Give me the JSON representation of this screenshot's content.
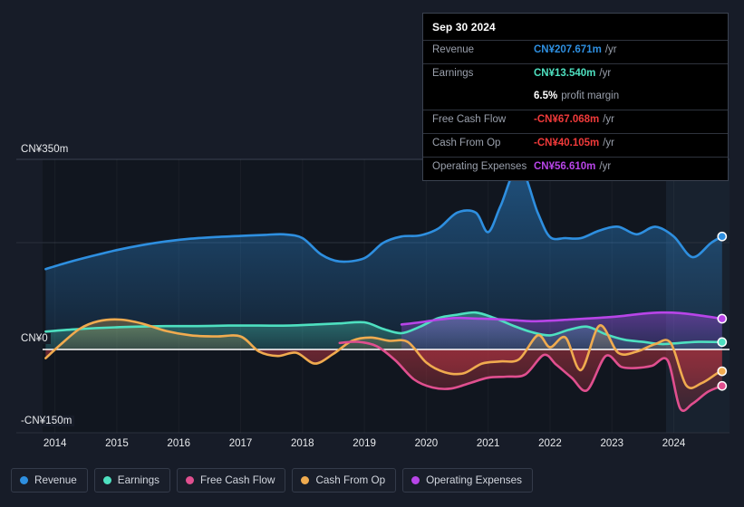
{
  "chart_data": {
    "type": "area",
    "title": "",
    "xlabel": "",
    "ylabel": "",
    "currency": "CN¥",
    "ylim": [
      -150,
      350
    ],
    "grid": true,
    "legend_position": "bottom",
    "y_ticks": [
      {
        "label": "CN¥350m",
        "value": 350
      },
      {
        "label": "CN¥0",
        "value": 0
      },
      {
        "label": "-CN¥150m",
        "value": -150
      }
    ],
    "x_ticks": [
      "2014",
      "2015",
      "2016",
      "2017",
      "2018",
      "2019",
      "2020",
      "2021",
      "2022",
      "2023",
      "2024"
    ],
    "x_range": [
      2013.8,
      2024.9
    ],
    "series": [
      {
        "name": "Revenue",
        "color": "#2e8fe0",
        "x": [
          2013.85,
          2014.2,
          2014.6,
          2015.0,
          2015.4,
          2015.8,
          2016.2,
          2016.6,
          2017.0,
          2017.4,
          2017.7,
          2018.0,
          2018.3,
          2018.6,
          2019.0,
          2019.3,
          2019.6,
          2019.9,
          2020.2,
          2020.5,
          2020.8,
          2021.0,
          2021.2,
          2021.5,
          2021.8,
          2022.0,
          2022.25,
          2022.5,
          2022.8,
          2023.1,
          2023.4,
          2023.7,
          2024.0,
          2024.3,
          2024.6,
          2024.78
        ],
        "values": [
          148,
          160,
          172,
          183,
          192,
          199,
          204,
          207,
          209,
          211,
          212,
          205,
          175,
          162,
          168,
          196,
          208,
          210,
          223,
          252,
          252,
          216,
          264,
          338,
          252,
          207,
          205,
          205,
          219,
          226,
          212,
          226,
          208,
          170,
          196,
          208
        ]
      },
      {
        "name": "Earnings",
        "color": "#4ee0c0",
        "x": [
          2013.85,
          2014.3,
          2014.8,
          2015.3,
          2015.8,
          2016.3,
          2016.8,
          2017.3,
          2017.8,
          2018.2,
          2018.6,
          2019.0,
          2019.3,
          2019.6,
          2019.9,
          2020.2,
          2020.5,
          2020.8,
          2021.1,
          2021.4,
          2021.7,
          2022.0,
          2022.3,
          2022.6,
          2022.9,
          2023.2,
          2023.5,
          2023.8,
          2024.1,
          2024.4,
          2024.78
        ],
        "values": [
          33,
          37,
          40,
          42,
          43,
          43,
          44,
          44,
          44,
          46,
          48,
          50,
          38,
          30,
          42,
          58,
          64,
          68,
          58,
          44,
          32,
          26,
          36,
          42,
          28,
          18,
          14,
          10,
          12,
          14,
          13.54
        ]
      },
      {
        "name": "Free Cash Flow",
        "color": "#e04f8f",
        "x": [
          2018.6,
          2018.9,
          2019.2,
          2019.5,
          2019.8,
          2020.1,
          2020.4,
          2020.7,
          2021.0,
          2021.3,
          2021.6,
          2021.9,
          2022.1,
          2022.35,
          2022.6,
          2022.9,
          2023.15,
          2023.4,
          2023.65,
          2023.9,
          2024.1,
          2024.3,
          2024.55,
          2024.78
        ],
        "values": [
          12,
          14,
          6,
          -20,
          -55,
          -70,
          -72,
          -62,
          -52,
          -50,
          -46,
          -10,
          -28,
          -52,
          -75,
          -12,
          -32,
          -34,
          -30,
          -20,
          -108,
          -100,
          -78,
          -67.068
        ]
      },
      {
        "name": "Cash From Op",
        "color": "#f0ab4f",
        "x": [
          2013.85,
          2014.1,
          2014.4,
          2014.7,
          2015.05,
          2015.4,
          2015.8,
          2016.2,
          2016.6,
          2017.0,
          2017.3,
          2017.6,
          2017.9,
          2018.2,
          2018.5,
          2018.8,
          2019.1,
          2019.4,
          2019.7,
          2020.0,
          2020.3,
          2020.6,
          2020.9,
          2021.2,
          2021.5,
          2021.8,
          2022.0,
          2022.25,
          2022.5,
          2022.8,
          2023.1,
          2023.4,
          2023.7,
          2023.95,
          2024.2,
          2024.45,
          2024.7,
          2024.78
        ],
        "values": [
          -16,
          10,
          38,
          52,
          55,
          48,
          34,
          26,
          24,
          24,
          -4,
          -12,
          -6,
          -26,
          -8,
          16,
          22,
          16,
          14,
          -24,
          -42,
          -44,
          -26,
          -22,
          -18,
          26,
          4,
          22,
          -38,
          44,
          -6,
          -4,
          10,
          12,
          -66,
          -62,
          -44,
          -40.105
        ]
      },
      {
        "name": "Operating Expenses",
        "color": "#b845e8",
        "x": [
          2019.6,
          2019.9,
          2020.2,
          2020.5,
          2020.8,
          2021.1,
          2021.4,
          2021.7,
          2022.0,
          2022.3,
          2022.6,
          2022.9,
          2023.2,
          2023.5,
          2023.8,
          2024.1,
          2024.4,
          2024.78
        ],
        "values": [
          46,
          50,
          55,
          58,
          57,
          56,
          54,
          52,
          53,
          55,
          57,
          59,
          62,
          66,
          68,
          67,
          63,
          56.61
        ]
      }
    ]
  },
  "tooltip": {
    "date": "Sep 30 2024",
    "rows": [
      {
        "key": "Revenue",
        "value": "CN¥207.671m",
        "unit": "/yr",
        "color": "#2e8fe0"
      },
      {
        "key": "Earnings",
        "value": "CN¥13.540m",
        "unit": "/yr",
        "color": "#4ee0c0"
      },
      {
        "key": "",
        "value": "6.5%",
        "unit": "profit margin",
        "color": "#ffffff"
      },
      {
        "key": "Free Cash Flow",
        "value": "-CN¥67.068m",
        "unit": "/yr",
        "color": "#f03a3a"
      },
      {
        "key": "Cash From Op",
        "value": "-CN¥40.105m",
        "unit": "/yr",
        "color": "#f03a3a"
      },
      {
        "key": "Operating Expenses",
        "value": "CN¥56.610m",
        "unit": "/yr",
        "color": "#b845e8"
      }
    ]
  },
  "legend": {
    "items": [
      {
        "label": "Revenue",
        "color": "#2e8fe0"
      },
      {
        "label": "Earnings",
        "color": "#4ee0c0"
      },
      {
        "label": "Free Cash Flow",
        "color": "#e04f8f"
      },
      {
        "label": "Cash From Op",
        "color": "#f0ab4f"
      },
      {
        "label": "Operating Expenses",
        "color": "#b845e8"
      }
    ]
  }
}
